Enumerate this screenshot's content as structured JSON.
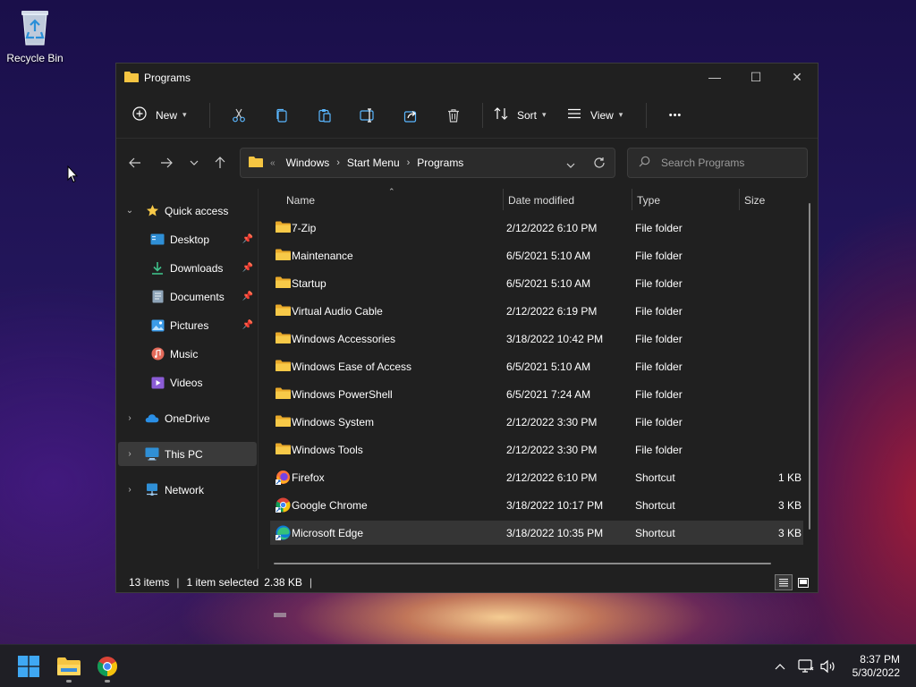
{
  "desktop": {
    "recycle_bin_label": "Recycle Bin"
  },
  "window": {
    "title": "Programs",
    "controls": {
      "minimize": "—",
      "maximize": "☐",
      "close": "✕"
    }
  },
  "toolbar": {
    "new_label": "New",
    "sort_label": "Sort",
    "view_label": "View",
    "more_label": "•••",
    "icons": [
      "cut-icon",
      "copy-icon",
      "paste-icon",
      "rename-icon",
      "share-icon",
      "delete-icon"
    ]
  },
  "address": {
    "breadcrumbs": [
      "Windows",
      "Start Menu",
      "Programs"
    ],
    "overflow": "«"
  },
  "search": {
    "placeholder": "Search Programs"
  },
  "sidebar": {
    "items": [
      {
        "label": "Quick access",
        "icon": "star-icon",
        "expanded": true
      },
      {
        "label": "Desktop",
        "icon": "desktop-icon",
        "pinned": true
      },
      {
        "label": "Downloads",
        "icon": "download-icon",
        "pinned": true
      },
      {
        "label": "Documents",
        "icon": "documents-icon",
        "pinned": true
      },
      {
        "label": "Pictures",
        "icon": "pictures-icon",
        "pinned": true
      },
      {
        "label": "Music",
        "icon": "music-icon"
      },
      {
        "label": "Videos",
        "icon": "videos-icon"
      },
      {
        "label": "OneDrive",
        "icon": "cloud-icon"
      },
      {
        "label": "This PC",
        "icon": "computer-icon",
        "selected": true
      },
      {
        "label": "Network",
        "icon": "network-icon"
      }
    ]
  },
  "columns": {
    "name": "Name",
    "date": "Date modified",
    "type": "Type",
    "size": "Size"
  },
  "files": [
    {
      "name": "7-Zip",
      "date": "2/12/2022 6:10 PM",
      "type": "File folder",
      "size": "",
      "icon": "folder-icon"
    },
    {
      "name": "Maintenance",
      "date": "6/5/2021 5:10 AM",
      "type": "File folder",
      "size": "",
      "icon": "folder-icon"
    },
    {
      "name": "Startup",
      "date": "6/5/2021 5:10 AM",
      "type": "File folder",
      "size": "",
      "icon": "folder-icon"
    },
    {
      "name": "Virtual Audio Cable",
      "date": "2/12/2022 6:19 PM",
      "type": "File folder",
      "size": "",
      "icon": "folder-icon"
    },
    {
      "name": "Windows Accessories",
      "date": "3/18/2022 10:42 PM",
      "type": "File folder",
      "size": "",
      "icon": "folder-icon"
    },
    {
      "name": "Windows Ease of Access",
      "date": "6/5/2021 5:10 AM",
      "type": "File folder",
      "size": "",
      "icon": "folder-icon"
    },
    {
      "name": "Windows PowerShell",
      "date": "6/5/2021 7:24 AM",
      "type": "File folder",
      "size": "",
      "icon": "folder-icon"
    },
    {
      "name": "Windows System",
      "date": "2/12/2022 3:30 PM",
      "type": "File folder",
      "size": "",
      "icon": "folder-icon"
    },
    {
      "name": "Windows Tools",
      "date": "2/12/2022 3:30 PM",
      "type": "File folder",
      "size": "",
      "icon": "folder-icon"
    },
    {
      "name": "Firefox",
      "date": "2/12/2022 6:10 PM",
      "type": "Shortcut",
      "size": "1 KB",
      "icon": "firefox-icon"
    },
    {
      "name": "Google Chrome",
      "date": "3/18/2022 10:17 PM",
      "type": "Shortcut",
      "size": "3 KB",
      "icon": "chrome-icon"
    },
    {
      "name": "Microsoft Edge",
      "date": "3/18/2022 10:35 PM",
      "type": "Shortcut",
      "size": "3 KB",
      "icon": "edge-icon",
      "selected": true
    }
  ],
  "status": {
    "item_count": "13 items",
    "selection": "1 item selected",
    "selection_size": "2.38 KB"
  },
  "taskbar": {
    "apps": [
      "start-icon",
      "file-explorer-icon",
      "chrome-icon"
    ],
    "time": "8:37 PM",
    "date": "5/30/2022"
  },
  "colors": {
    "window_bg": "#202020",
    "folder": "#f5c542",
    "selection": "#353535",
    "accent": "#4cc2ff"
  }
}
